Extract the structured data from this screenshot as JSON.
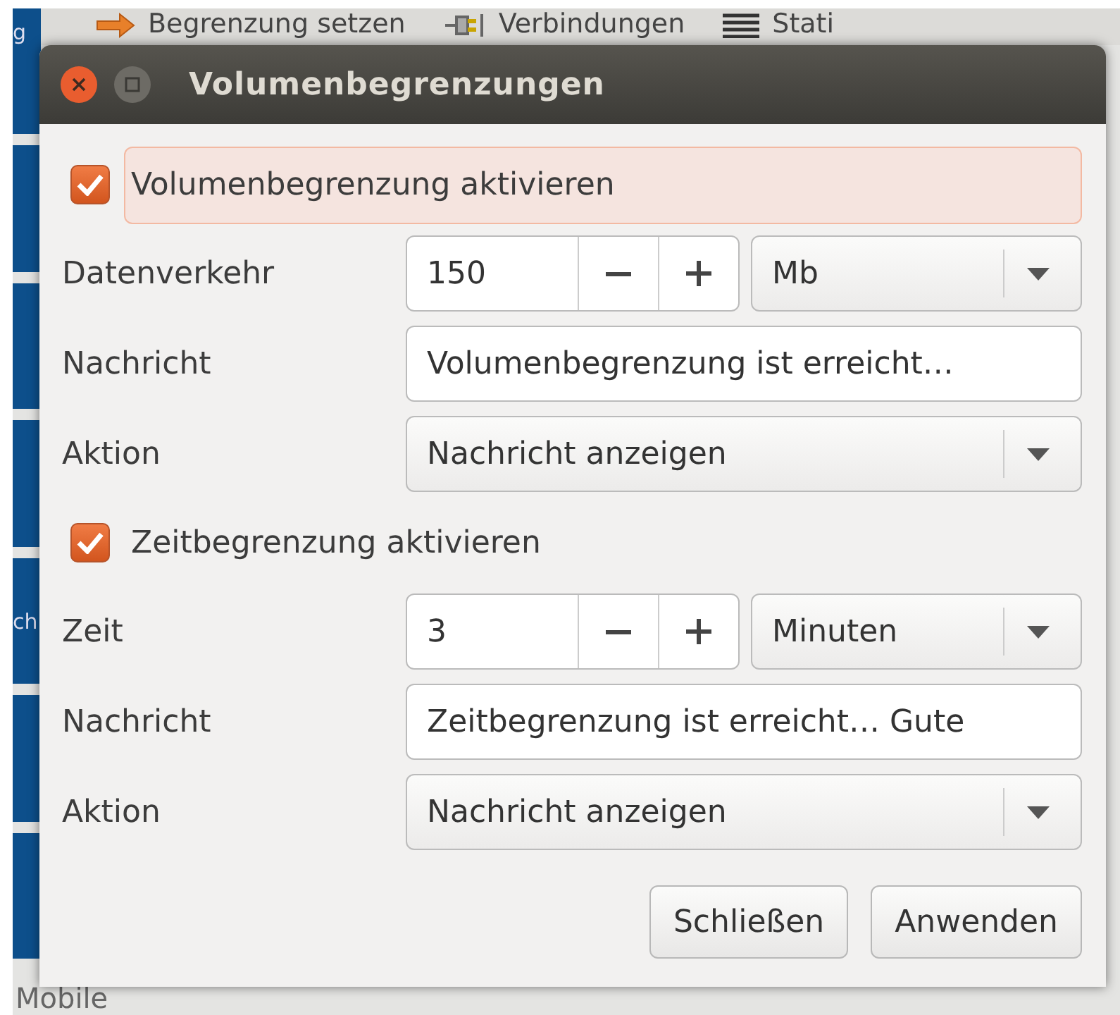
{
  "background": {
    "toolbar": [
      {
        "label": "Begrenzung setzen"
      },
      {
        "label": "Verbindungen"
      },
      {
        "label": "Stati"
      }
    ],
    "sidebar_fragments": [
      "g",
      "ch"
    ],
    "bottom_label": "Mobile"
  },
  "dialog": {
    "title": "Volumenbegrenzungen",
    "sections": [
      {
        "toggle": {
          "label": "Volumenbegrenzung aktivieren",
          "checked": true,
          "focused": true
        },
        "rows": [
          {
            "kind": "spin",
            "label": "Datenverkehr",
            "value": "150",
            "unit": "Mb"
          },
          {
            "kind": "entry",
            "label": "Nachricht",
            "value": "Volumenbegrenzung ist erreicht…"
          },
          {
            "kind": "combo",
            "label": "Aktion",
            "value": "Nachricht anzeigen"
          }
        ]
      },
      {
        "toggle": {
          "label": "Zeitbegrenzung aktivieren",
          "checked": true,
          "focused": false
        },
        "rows": [
          {
            "kind": "spin",
            "label": "Zeit",
            "value": "3",
            "unit": "Minuten"
          },
          {
            "kind": "entry",
            "label": "Nachricht",
            "value": "Zeitbegrenzung ist erreicht… Gute"
          },
          {
            "kind": "combo",
            "label": "Aktion",
            "value": "Nachricht anzeigen"
          }
        ]
      }
    ],
    "buttons": [
      "Schließen",
      "Anwenden"
    ]
  }
}
